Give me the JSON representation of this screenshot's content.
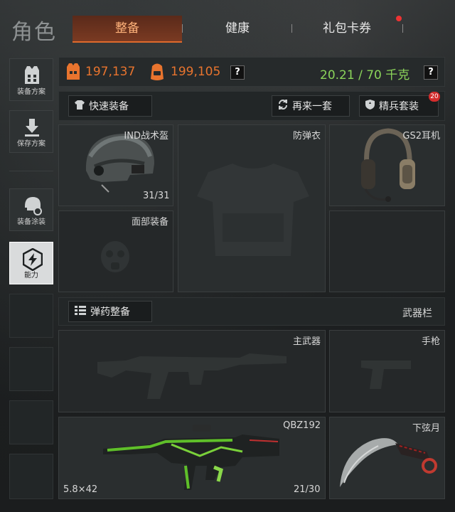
{
  "header": {
    "title": "角色",
    "tabs": [
      {
        "label": "整备",
        "active": true
      },
      {
        "label": "健康",
        "active": false
      },
      {
        "label": "礼包卡券",
        "active": false
      }
    ]
  },
  "sidebar": {
    "items": [
      {
        "label": "装备方案",
        "icon": "vest-icon"
      },
      {
        "label": "保存方案",
        "icon": "download-icon"
      },
      {
        "label": "装备涂装",
        "icon": "helmet-paint-icon"
      },
      {
        "label": "能力",
        "icon": "lightning-icon",
        "active": true
      }
    ]
  },
  "stats": {
    "vest_value": "197,137",
    "bag_value": "199,105",
    "help": "?",
    "weight": "20.21 / 70 千克",
    "weight_help": "?"
  },
  "actions": {
    "quick_equip": "快速装备",
    "repeat_set": "再来一套",
    "elite_set": "精兵套装",
    "elite_badge": "20"
  },
  "gear": {
    "helmet": {
      "name": "IND战术盔",
      "durability": "31/31"
    },
    "armor": {
      "name": "防弹衣"
    },
    "headset": {
      "name": "GS2耳机"
    },
    "face": {
      "name": "面部装备"
    }
  },
  "ammo": {
    "button": "弹药整备",
    "weapons_label": "武器栏"
  },
  "weapons": {
    "primary_slot": "主武器",
    "pistol_slot": "手枪",
    "rifle": {
      "name": "QBZ192",
      "caliber": "5.8×42",
      "ammo": "21/30"
    },
    "melee": {
      "name": "下弦月"
    }
  },
  "colors": {
    "accent": "#e8742e",
    "weight": "#8bd45a",
    "badge": "#d42c2c"
  }
}
